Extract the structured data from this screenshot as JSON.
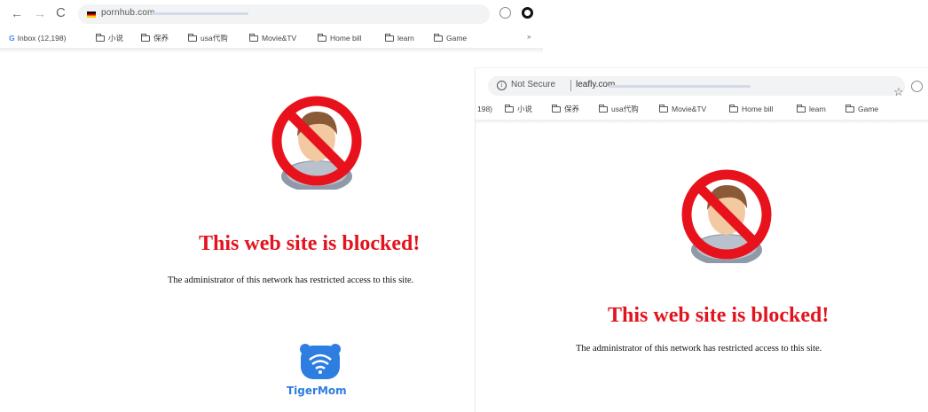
{
  "left_window": {
    "nav": {
      "back": "←",
      "forward": "→",
      "reload": "C"
    },
    "url": "pornhub.com",
    "bookmarks": [
      {
        "label": "Inbox (12,198)",
        "icon": "gmail-icon"
      },
      {
        "label": "小说",
        "icon": "folder-icon"
      },
      {
        "label": "保养",
        "icon": "folder-icon"
      },
      {
        "label": "usa代购",
        "icon": "folder-icon"
      },
      {
        "label": "Movie&TV",
        "icon": "folder-icon"
      },
      {
        "label": "Home bill",
        "icon": "folder-icon"
      },
      {
        "label": "learn",
        "icon": "folder-icon"
      },
      {
        "label": "Game",
        "icon": "folder-icon"
      }
    ],
    "overflow": "»",
    "page": {
      "title": "This web site is blocked!",
      "message": "The administrator of this network has restricted access to this site."
    },
    "logo_text": "TigerMom"
  },
  "right_window": {
    "security_label": "Not Secure",
    "url": "leafly.com",
    "bookmarks": [
      {
        "label": "198)",
        "icon": ""
      },
      {
        "label": "小说",
        "icon": "folder-icon"
      },
      {
        "label": "保养",
        "icon": "folder-icon"
      },
      {
        "label": "usa代购",
        "icon": "folder-icon"
      },
      {
        "label": "Movie&TV",
        "icon": "folder-icon"
      },
      {
        "label": "Home bill",
        "icon": "folder-icon"
      },
      {
        "label": "learn",
        "icon": "folder-icon"
      },
      {
        "label": "Game",
        "icon": "folder-icon"
      }
    ],
    "page": {
      "title": "This web site is blocked!",
      "message": "The administrator of this network has restricted access to this site."
    }
  },
  "colors": {
    "block_red": "#e3131d",
    "tiger_blue": "#2e7de1",
    "omnibox_bg": "#f1f3f4"
  }
}
